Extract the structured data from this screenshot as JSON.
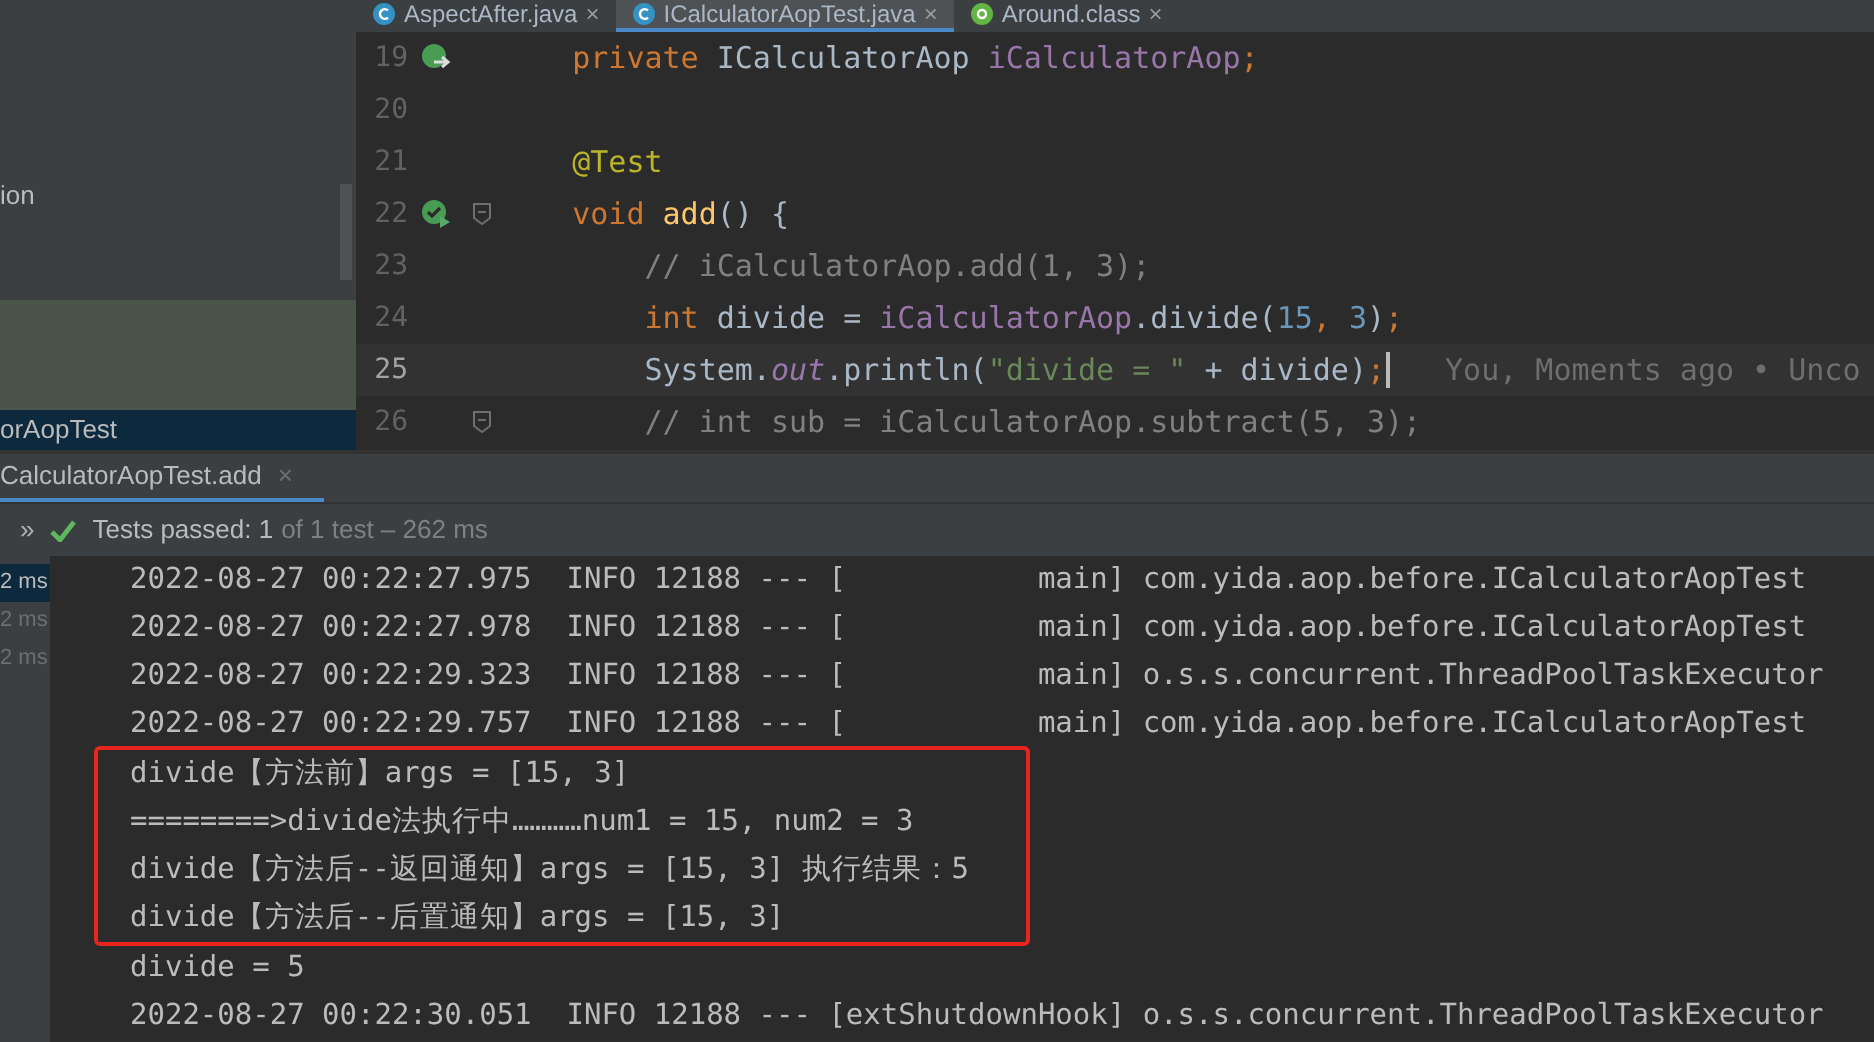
{
  "sidebar": {
    "items": [
      {
        "label": "ion",
        "selected": false
      },
      {
        "label": "orAopTest",
        "selected": true
      }
    ]
  },
  "editor_tabs": [
    {
      "label": "AspectAfter.java",
      "kind": "class",
      "selected": false,
      "close": "×"
    },
    {
      "label": "ICalculatorAopTest.java",
      "kind": "class",
      "selected": true,
      "close": "×"
    },
    {
      "label": "Around.class",
      "kind": "annotation",
      "selected": false,
      "close": "×"
    }
  ],
  "code_lines": [
    {
      "number": "19",
      "kind": "implemented",
      "fold": false,
      "current": false,
      "tokens": [
        {
          "kind": "keyword",
          "text": "    private "
        },
        {
          "kind": "plain",
          "text": "ICalculatorAop "
        },
        {
          "kind": "field",
          "text": "iCalculatorAop"
        },
        {
          "kind": "keyword",
          "text": ";"
        }
      ]
    },
    {
      "number": "20",
      "kind": "plain",
      "fold": false,
      "current": false
    },
    {
      "number": "21",
      "kind": "plain",
      "fold": false,
      "current": false,
      "tokens": [
        {
          "kind": "annotation",
          "text": "    @Test"
        }
      ]
    },
    {
      "number": "22",
      "kind": "test-passed",
      "fold": true,
      "current": false,
      "tokens": [
        {
          "kind": "keyword",
          "text": "    void "
        },
        {
          "kind": "method",
          "text": "add"
        },
        {
          "kind": "plain",
          "text": "() {"
        }
      ]
    },
    {
      "number": "23",
      "kind": "plain",
      "fold": false,
      "current": false,
      "tokens": [
        {
          "kind": "comment",
          "text": "        // iCalculatorAop.add(1, 3);"
        }
      ]
    },
    {
      "number": "24",
      "kind": "plain",
      "fold": false,
      "current": false,
      "tokens": [
        {
          "kind": "keyword",
          "text": "        int "
        },
        {
          "kind": "plain",
          "text": "divide = "
        },
        {
          "kind": "field",
          "text": "iCalculatorAop"
        },
        {
          "kind": "plain",
          "text": ".divide("
        },
        {
          "kind": "number",
          "text": "15"
        },
        {
          "kind": "keyword",
          "text": ", "
        },
        {
          "kind": "number",
          "text": "3"
        },
        {
          "kind": "plain",
          "text": ")"
        },
        {
          "kind": "keyword",
          "text": ";"
        }
      ]
    },
    {
      "number": "25",
      "kind": "plain",
      "fold": false,
      "current": true,
      "hint": "You, Moments ago • Unco",
      "tokens": [
        {
          "kind": "plain",
          "text": "        System."
        },
        {
          "kind": "static",
          "text": "out"
        },
        {
          "kind": "plain",
          "text": ".println("
        },
        {
          "kind": "string",
          "text": "\"divide = \""
        },
        {
          "kind": "plain",
          "text": " + divide)"
        },
        {
          "kind": "keyword",
          "text": ";"
        }
      ]
    },
    {
      "number": "26",
      "kind": "plain",
      "fold": true,
      "current": false,
      "tokens": [
        {
          "kind": "comment",
          "text": "        // int sub = iCalculatorAop.subtract(5, 3);"
        }
      ]
    }
  ],
  "run_tab": {
    "label": "CalculatorAopTest.add",
    "close": "×"
  },
  "run_toolbar": {
    "more": "»",
    "status": "Tests passed: 1",
    "detail": "of 1 test – 262 ms"
  },
  "durations": [
    {
      "label": "2 ms",
      "selected": true
    },
    {
      "label": "2 ms",
      "selected": false
    },
    {
      "label": "2 ms",
      "selected": false
    }
  ],
  "console": [
    {
      "kind": "plain",
      "lines": [
        "2022-08-27 00:22:27.975  INFO 12188 --- [           main] com.yida.aop.before.ICalculatorAopTest",
        "2022-08-27 00:22:27.978  INFO 12188 --- [           main] com.yida.aop.before.ICalculatorAopTest",
        "2022-08-27 00:22:29.323  INFO 12188 --- [           main] o.s.s.concurrent.ThreadPoolTaskExecutor",
        "2022-08-27 00:22:29.757  INFO 12188 --- [           main] com.yida.aop.before.ICalculatorAopTest"
      ]
    },
    {
      "kind": "boxed",
      "lines": [
        "divide【方法前】args = [15, 3]",
        "========>divide法执行中…………num1 = 15, num2 = 3",
        "divide【方法后--返回通知】args = [15, 3] 执行结果：5",
        "divide【方法后--后置通知】args = [15, 3]"
      ]
    },
    {
      "kind": "plain",
      "lines": [
        "divide = 5",
        "2022-08-27 00:22:30.051  INFO 12188 --- [extShutdownHook] o.s.s.concurrent.ThreadPoolTaskExecutor"
      ]
    }
  ]
}
